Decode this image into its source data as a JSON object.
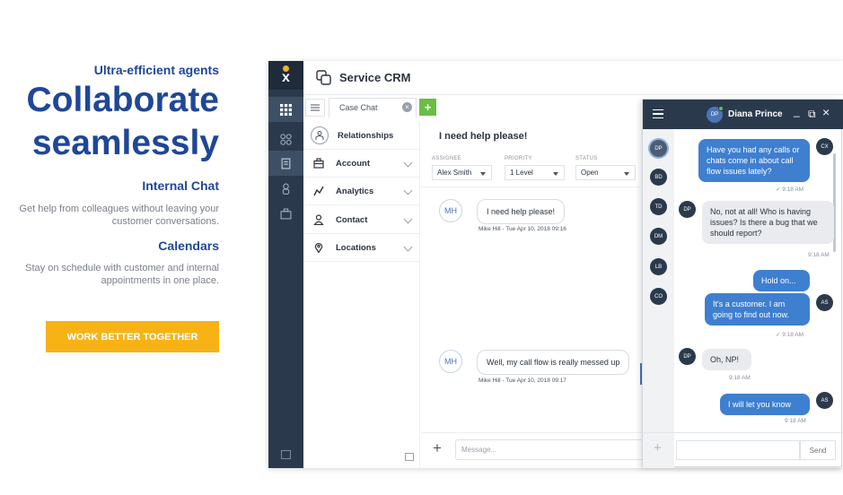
{
  "marketing": {
    "eyebrow": "Ultra-efficient agents",
    "headline_line1": "Collaborate",
    "headline_line2": "seamlessly",
    "feature1_title": "Internal Chat",
    "feature1_desc": "Get help from colleagues without leaving your customer conversations.",
    "feature2_title": "Calendars",
    "feature2_desc": "Stay on schedule with customer and internal appointments in one place.",
    "cta_label": "WORK BETTER TOGETHER",
    "cta_color": "#f7b315",
    "brand_color": "#1f4796"
  },
  "app": {
    "logo_letter": "x",
    "title": "Service CRM",
    "rail_icons": [
      "grid-icon",
      "circles-icon",
      "document-icon",
      "person-icon",
      "briefcase-icon"
    ],
    "tab_label": "Case Chat",
    "tab_close": "×",
    "tab_add": "+",
    "nav": [
      {
        "label": "Relationships",
        "icon": "relationships-icon"
      },
      {
        "label": "Account",
        "icon": "briefcase-icon"
      },
      {
        "label": "Analytics",
        "icon": "analytics-icon"
      },
      {
        "label": "Contact",
        "icon": "contact-icon"
      },
      {
        "label": "Locations",
        "icon": "location-pin-icon"
      }
    ]
  },
  "conversation": {
    "title": "I need help please!",
    "fields": [
      {
        "label": "ASSIGNEE",
        "value": "Alex Smith"
      },
      {
        "label": "PRIORITY",
        "value": "1 Level"
      },
      {
        "label": "STATUS",
        "value": "Open"
      }
    ],
    "messages": [
      {
        "initials": "MH",
        "text": "I need help please!",
        "meta": "Mike Hill - Tue Apr 10, 2018 09:16"
      },
      {
        "initials": "MH",
        "text": "Well, my call flow is really messed up",
        "meta": "Mike Hill - Tue Apr 10, 2018 09:17"
      }
    ],
    "compose_plus": "+",
    "compose_placeholder": "Message..."
  },
  "chat": {
    "user_initials": "DP",
    "user_name": "Diana Prince",
    "controls": [
      "_",
      "⧉",
      "×"
    ],
    "contacts": [
      "DP",
      "BD",
      "TD",
      "DM",
      "LB",
      "CO"
    ],
    "messages": [
      {
        "from": "CX",
        "dir": "out",
        "text": "Have you had any calls or chats come in about call flow issues lately?",
        "time": "✓ 9:18 AM"
      },
      {
        "from": "DP",
        "dir": "in",
        "text": "No, not at all! Who is having issues? Is there a bug that we should report?",
        "time": "9:18 AM"
      },
      {
        "from": "",
        "dir": "out",
        "text": "Hold on...",
        "time": ""
      },
      {
        "from": "AS",
        "dir": "out",
        "text": "It's a customer. I am going to find out now.",
        "time": "✓ 9:18 AM"
      },
      {
        "from": "DP",
        "dir": "in",
        "text": "Oh, NP!",
        "time": "9:18 AM"
      },
      {
        "from": "AS",
        "dir": "out",
        "text": "I will let you know",
        "time": "9:18 AM"
      }
    ],
    "footer_plus": "+",
    "send_label": "Send"
  }
}
